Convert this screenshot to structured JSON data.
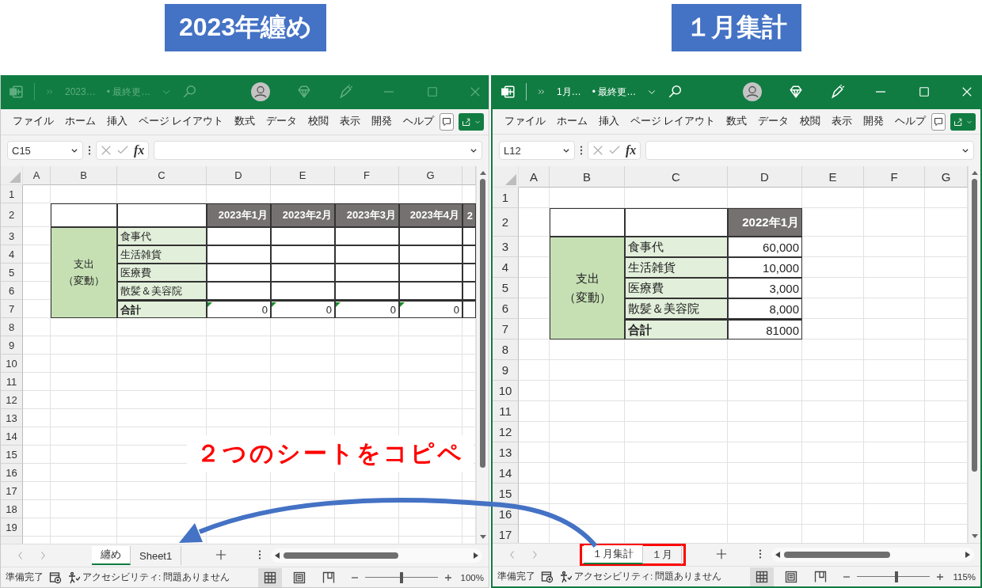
{
  "captions": [
    {
      "text": "2023年纏め"
    },
    {
      "text": "１月集計"
    }
  ],
  "windows": [
    {
      "active": false,
      "file_name": "2023…",
      "save_status": "• 最終更…",
      "menu": [
        "ファイル",
        "ホーム",
        "挿入",
        "ページ レイアウト",
        "数式",
        "データ",
        "校閲",
        "表示",
        "開発",
        "ヘルプ"
      ],
      "name_box": "C15",
      "fx": "fx",
      "columns": [
        "A",
        "B",
        "C",
        "D",
        "E",
        "F",
        "G"
      ],
      "rows": [
        "1",
        "2",
        "3",
        "4",
        "5",
        "6",
        "7",
        "8",
        "9",
        "10",
        "11",
        "12",
        "13",
        "14",
        "15",
        "16",
        "17",
        "18",
        "19"
      ],
      "table": {
        "header": [
          "2023年1月",
          "2023年2月",
          "2023年3月",
          "2023年4月",
          "2"
        ],
        "group_label": [
          "支出",
          "（変動）"
        ],
        "items": [
          {
            "label": "食事代"
          },
          {
            "label": "生活雑貨"
          },
          {
            "label": "医療費"
          },
          {
            "label": "散髪＆美容院"
          }
        ],
        "total": {
          "label": "合計",
          "values": [
            "0",
            "0",
            "0",
            "0"
          ],
          "flagged": true
        }
      },
      "sheet_tabs": [
        {
          "label": "纏め",
          "selected": true
        },
        {
          "label": "Sheet1",
          "selected": false
        }
      ],
      "tabs_highlighted": false,
      "status": "準備完了",
      "accessibility": "アクセシビリティ: 問題ありません",
      "view_buttons": [
        {
          "kind": "normal",
          "selected": true
        },
        {
          "kind": "page_layout",
          "selected": false
        },
        {
          "kind": "page_break",
          "selected": false
        }
      ],
      "zoom": {
        "level": 0.5,
        "reading": "100%"
      }
    },
    {
      "active": true,
      "file_name": "1月…",
      "save_status": "• 最終更…",
      "menu": [
        "ファイル",
        "ホーム",
        "挿入",
        "ページ レイアウト",
        "数式",
        "データ",
        "校閲",
        "表示",
        "開発",
        "ヘルプ"
      ],
      "name_box": "L12",
      "fx": "fx",
      "columns": [
        "A",
        "B",
        "C",
        "D",
        "E",
        "F",
        "G"
      ],
      "rows": [
        "1",
        "2",
        "3",
        "4",
        "5",
        "6",
        "7",
        "8",
        "9",
        "10",
        "11",
        "12",
        "13",
        "14",
        "15",
        "16",
        "17"
      ],
      "table": {
        "header": [
          "2022年1月"
        ],
        "group_label": [
          "支出",
          "（変動）"
        ],
        "items": [
          {
            "label": "食事代",
            "values": [
              "60,000"
            ]
          },
          {
            "label": "生活雑貨",
            "values": [
              "10,000"
            ]
          },
          {
            "label": "医療費",
            "values": [
              "3,000"
            ]
          },
          {
            "label": "散髪＆美容院",
            "values": [
              "8,000"
            ]
          }
        ],
        "total": {
          "label": "合計",
          "values": [
            "81000"
          ],
          "flagged": false
        }
      },
      "sheet_tabs": [
        {
          "label": "１月集計",
          "selected": true
        },
        {
          "label": "１月",
          "selected": false
        }
      ],
      "tabs_highlighted": true,
      "status": "準備完了",
      "accessibility": "アクセシビリティ: 問題ありません",
      "view_buttons": [
        {
          "kind": "normal",
          "selected": true
        },
        {
          "kind": "page_layout",
          "selected": false
        },
        {
          "kind": "page_break",
          "selected": false
        }
      ],
      "zoom": {
        "level": 0.54,
        "reading": "115%"
      }
    }
  ],
  "annotation": {
    "text": "２つのシートをコピペ"
  }
}
